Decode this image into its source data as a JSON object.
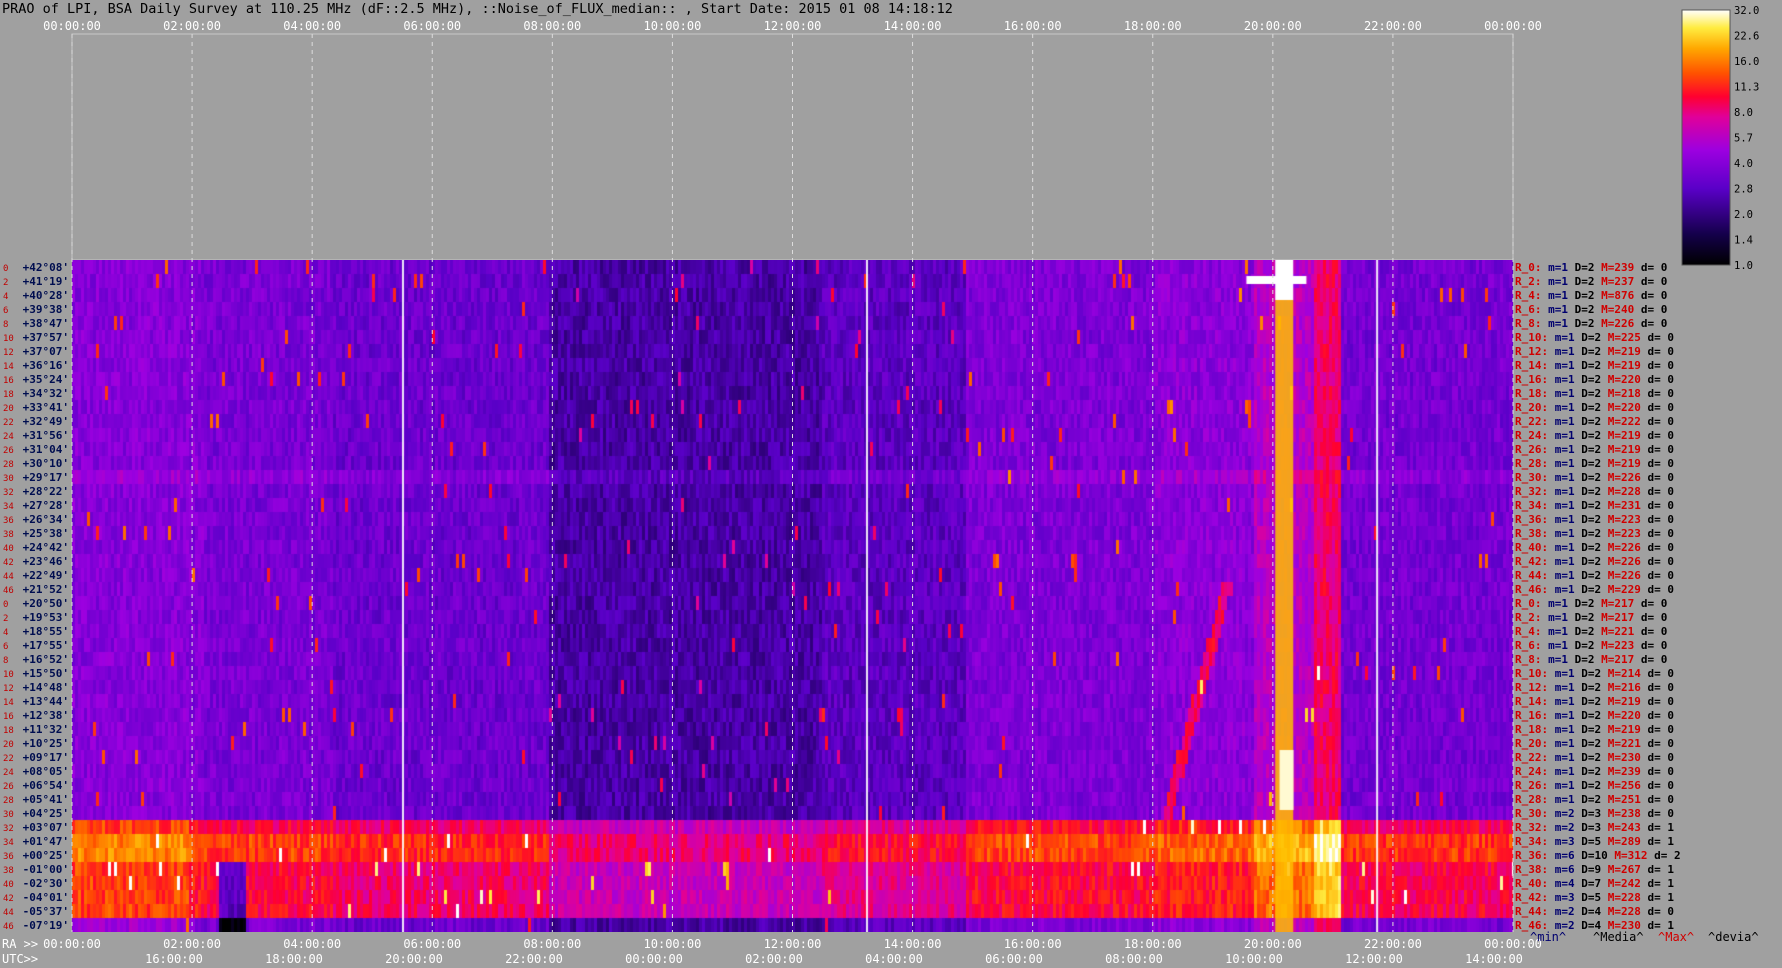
{
  "title": "PRAO of LPI, BSA Daily Survey at 110.25 MHz (dF::2.5 MHz), ::Noise_of_FLUX_median:: , Start Date: 2015 01 08 14:18:12",
  "chart_data": {
    "type": "heatmap",
    "ra_ticks": [
      "00:00:00",
      "02:00:00",
      "04:00:00",
      "06:00:00",
      "08:00:00",
      "10:00:00",
      "12:00:00",
      "14:00:00",
      "16:00:00",
      "18:00:00",
      "20:00:00",
      "22:00:00",
      "00:00:00"
    ],
    "utc_ticks": [
      "16:00:00",
      "18:00:00",
      "20:00:00",
      "22:00:00",
      "00:00:00",
      "02:00:00",
      "04:00:00",
      "06:00:00",
      "08:00:00",
      "10:00:00",
      "12:00:00",
      "14:00:00"
    ],
    "ra_label": "RA >>",
    "utc_label": "UTC>>",
    "declinations": [
      "+42°08'",
      "+41°19'",
      "+40°28'",
      "+39°38'",
      "+38°47'",
      "+37°57'",
      "+37°07'",
      "+36°16'",
      "+35°24'",
      "+34°32'",
      "+33°41'",
      "+32°49'",
      "+31°56'",
      "+31°04'",
      "+30°10'",
      "+29°17'",
      "+28°22'",
      "+27°28'",
      "+26°34'",
      "+25°38'",
      "+24°42'",
      "+23°46'",
      "+22°49'",
      "+21°52'",
      "+20°50'",
      "+19°53'",
      "+18°55'",
      "+17°55'",
      "+16°52'",
      "+15°50'",
      "+14°48'",
      "+13°44'",
      "+12°38'",
      "+11°32'",
      "+10°25'",
      "+09°17'",
      "+08°05'",
      "+06°54'",
      "+05°41'",
      "+04°25'",
      "+03°07'",
      "+01°47'",
      "+00°25'",
      "-01°00'",
      "-02°30'",
      "-04°01'",
      "-05°37'",
      "-07°19'"
    ],
    "row_numbers": [
      "0",
      "2",
      "4",
      "6",
      "8",
      "10",
      "12",
      "14",
      "16",
      "18",
      "20",
      "22",
      "24",
      "26",
      "28",
      "30",
      "32",
      "34",
      "36",
      "38",
      "40",
      "42",
      "44",
      "46",
      "0",
      "2",
      "4",
      "6",
      "8",
      "10",
      "12",
      "14",
      "16",
      "18",
      "20",
      "22",
      "24",
      "26",
      "28",
      "30",
      "32",
      "34",
      "36",
      "38",
      "40",
      "42",
      "44",
      "46"
    ],
    "colorbar": {
      "ticks": [
        "32.0",
        "22.6",
        "16.0",
        "11.3",
        "8.0",
        "5.7",
        "4.0",
        "2.8",
        "2.0",
        "1.4",
        "1.0"
      ],
      "scale": "log"
    },
    "row_stats": [
      {
        "r": "R_0:",
        "m": "m=1",
        "d": "D=2",
        "M": "M=239",
        "v": "d= 0"
      },
      {
        "r": "R_2:",
        "m": "m=1",
        "d": "D=2",
        "M": "M=237",
        "v": "d= 0"
      },
      {
        "r": "R_4:",
        "m": "m=1",
        "d": "D=2",
        "M": "M=876",
        "v": "d= 0"
      },
      {
        "r": "R_6:",
        "m": "m=1",
        "d": "D=2",
        "M": "M=240",
        "v": "d= 0"
      },
      {
        "r": "R_8:",
        "m": "m=1",
        "d": "D=2",
        "M": "M=226",
        "v": "d= 0"
      },
      {
        "r": "R_10:",
        "m": "m=1",
        "d": "D=2",
        "M": "M=225",
        "v": "d= 0"
      },
      {
        "r": "R_12:",
        "m": "m=1",
        "d": "D=2",
        "M": "M=219",
        "v": "d= 0"
      },
      {
        "r": "R_14:",
        "m": "m=1",
        "d": "D=2",
        "M": "M=219",
        "v": "d= 0"
      },
      {
        "r": "R_16:",
        "m": "m=1",
        "d": "D=2",
        "M": "M=220",
        "v": "d= 0"
      },
      {
        "r": "R_18:",
        "m": "m=1",
        "d": "D=2",
        "M": "M=218",
        "v": "d= 0"
      },
      {
        "r": "R_20:",
        "m": "m=1",
        "d": "D=2",
        "M": "M=220",
        "v": "d= 0"
      },
      {
        "r": "R_22:",
        "m": "m=1",
        "d": "D=2",
        "M": "M=222",
        "v": "d= 0"
      },
      {
        "r": "R_24:",
        "m": "m=1",
        "d": "D=2",
        "M": "M=219",
        "v": "d= 0"
      },
      {
        "r": "R_26:",
        "m": "m=1",
        "d": "D=2",
        "M": "M=219",
        "v": "d= 0"
      },
      {
        "r": "R_28:",
        "m": "m=1",
        "d": "D=2",
        "M": "M=219",
        "v": "d= 0"
      },
      {
        "r": "R_30:",
        "m": "m=1",
        "d": "D=2",
        "M": "M=226",
        "v": "d= 0"
      },
      {
        "r": "R_32:",
        "m": "m=1",
        "d": "D=2",
        "M": "M=228",
        "v": "d= 0"
      },
      {
        "r": "R_34:",
        "m": "m=1",
        "d": "D=2",
        "M": "M=231",
        "v": "d= 0"
      },
      {
        "r": "R_36:",
        "m": "m=1",
        "d": "D=2",
        "M": "M=223",
        "v": "d= 0"
      },
      {
        "r": "R_38:",
        "m": "m=1",
        "d": "D=2",
        "M": "M=223",
        "v": "d= 0"
      },
      {
        "r": "R_40:",
        "m": "m=1",
        "d": "D=2",
        "M": "M=226",
        "v": "d= 0"
      },
      {
        "r": "R_42:",
        "m": "m=1",
        "d": "D=2",
        "M": "M=226",
        "v": "d= 0"
      },
      {
        "r": "R_44:",
        "m": "m=1",
        "d": "D=2",
        "M": "M=226",
        "v": "d= 0"
      },
      {
        "r": "R_46:",
        "m": "m=1",
        "d": "D=2",
        "M": "M=229",
        "v": "d= 0"
      },
      {
        "r": "R_0:",
        "m": "m=1",
        "d": "D=2",
        "M": "M=217",
        "v": "d= 0"
      },
      {
        "r": "R_2:",
        "m": "m=1",
        "d": "D=2",
        "M": "M=217",
        "v": "d= 0"
      },
      {
        "r": "R_4:",
        "m": "m=1",
        "d": "D=2",
        "M": "M=221",
        "v": "d= 0"
      },
      {
        "r": "R_6:",
        "m": "m=1",
        "d": "D=2",
        "M": "M=223",
        "v": "d= 0"
      },
      {
        "r": "R_8:",
        "m": "m=1",
        "d": "D=2",
        "M": "M=217",
        "v": "d= 0"
      },
      {
        "r": "R_10:",
        "m": "m=1",
        "d": "D=2",
        "M": "M=214",
        "v": "d= 0"
      },
      {
        "r": "R_12:",
        "m": "m=1",
        "d": "D=2",
        "M": "M=216",
        "v": "d= 0"
      },
      {
        "r": "R_14:",
        "m": "m=1",
        "d": "D=2",
        "M": "M=219",
        "v": "d= 0"
      },
      {
        "r": "R_16:",
        "m": "m=1",
        "d": "D=2",
        "M": "M=220",
        "v": "d= 0"
      },
      {
        "r": "R_18:",
        "m": "m=1",
        "d": "D=2",
        "M": "M=219",
        "v": "d= 0"
      },
      {
        "r": "R_20:",
        "m": "m=1",
        "d": "D=2",
        "M": "M=221",
        "v": "d= 0"
      },
      {
        "r": "R_22:",
        "m": "m=1",
        "d": "D=2",
        "M": "M=230",
        "v": "d= 0"
      },
      {
        "r": "R_24:",
        "m": "m=1",
        "d": "D=2",
        "M": "M=239",
        "v": "d= 0"
      },
      {
        "r": "R_26:",
        "m": "m=1",
        "d": "D=2",
        "M": "M=256",
        "v": "d= 0"
      },
      {
        "r": "R_28:",
        "m": "m=1",
        "d": "D=2",
        "M": "M=251",
        "v": "d= 0"
      },
      {
        "r": "R_30:",
        "m": "m=2",
        "d": "D=3",
        "M": "M=238",
        "v": "d= 0"
      },
      {
        "r": "R_32:",
        "m": "m=2",
        "d": "D=3",
        "M": "M=243",
        "v": "d= 1"
      },
      {
        "r": "R_34:",
        "m": "m=3",
        "d": "D=5",
        "M": "M=289",
        "v": "d= 1"
      },
      {
        "r": "R_36:",
        "m": "m=6",
        "d": "D=10",
        "M": "M=312",
        "v": "d= 2"
      },
      {
        "r": "R_38:",
        "m": "m=6",
        "d": "D=9",
        "M": "M=267",
        "v": "d= 1"
      },
      {
        "r": "R_40:",
        "m": "m=4",
        "d": "D=7",
        "M": "M=242",
        "v": "d= 1"
      },
      {
        "r": "R_42:",
        "m": "m=3",
        "d": "D=5",
        "M": "M=228",
        "v": "d= 1"
      },
      {
        "r": "R_44:",
        "m": "m=2",
        "d": "D=4",
        "M": "M=228",
        "v": "d= 0"
      },
      {
        "r": "R_46:",
        "m": "m=2",
        "d": "D=4",
        "M": "M=230",
        "v": "d= 1"
      }
    ],
    "footer_legend": [
      "^min^",
      "^Media^",
      "^Max^",
      "^devia^"
    ]
  },
  "colors": {
    "background": "#a0a0a0",
    "legend_min": "#00006e",
    "legend_media": "#000000",
    "legend_max": "#d00000",
    "legend_devia": "#000000",
    "row_label": "#d00000"
  }
}
